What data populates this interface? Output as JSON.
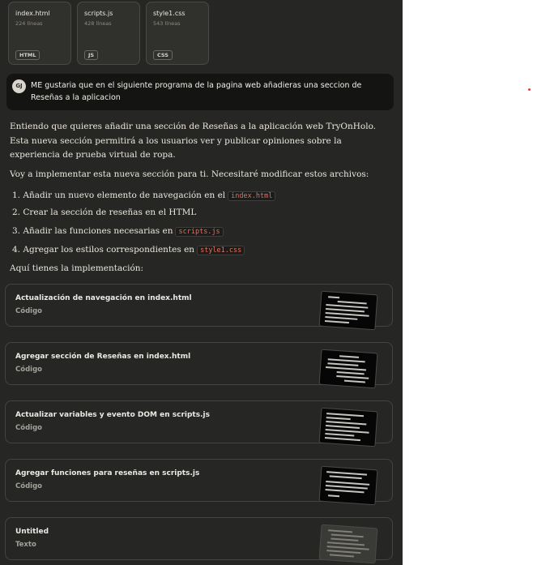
{
  "attachments": [
    {
      "name": "index.html",
      "lines": "224 líneas",
      "badge": "HTML"
    },
    {
      "name": "scripts.js",
      "lines": "428 líneas",
      "badge": "JS"
    },
    {
      "name": "style1.css",
      "lines": "543 líneas",
      "badge": "CSS"
    }
  ],
  "user_message": {
    "initials": "GJ",
    "text": "ME gustaria que en el siguiente programa de la pagina web añadieras una seccion de Reseñas a la aplicacion"
  },
  "reply": {
    "intro": "Entiendo que quieres añadir una sección de Reseñas a la aplicación web TryOnHolo. Esta nueva sección permitirá a los usuarios ver y publicar opiniones sobre la experiencia de prueba virtual de ropa.",
    "plan": "Voy a implementar esta nueva sección para ti. Necesitaré modificar estos archivos:",
    "steps": [
      {
        "text": "1. Añadir un nuevo elemento de navegación en el",
        "code": "index.html"
      },
      {
        "text": "2. Crear la sección de reseñas en el HTML",
        "code": ""
      },
      {
        "text": "3. Añadir las funciones necesarias en",
        "code": "scripts.js"
      },
      {
        "text": "4. Agregar los estilos correspondientes en",
        "code": "style1.css"
      }
    ],
    "outro": "Aquí tienes la implementación:"
  },
  "artifacts": [
    {
      "title": "Actualización de navegación en index.html",
      "type": "Código"
    },
    {
      "title": "Agregar sección de Reseñas en index.html",
      "type": "Código"
    },
    {
      "title": "Actualizar variables y evento DOM en scripts.js",
      "type": "Código"
    },
    {
      "title": "Agregar funciones para reseñas en scripts.js",
      "type": "Código"
    },
    {
      "title": "Untitled",
      "type": "Texto"
    }
  ],
  "colors": {
    "panel_bg": "#262624",
    "user_bubble_bg": "#141413",
    "inline_code": "#e0735f",
    "indicator_dot": "#e0413a"
  }
}
